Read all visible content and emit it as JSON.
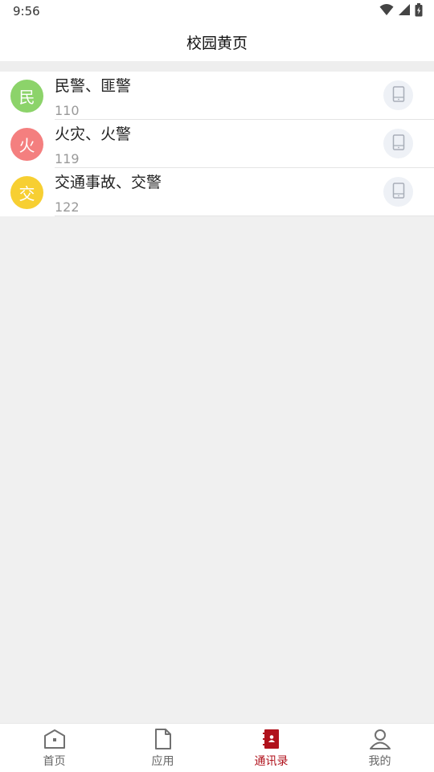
{
  "status_bar": {
    "time": "9:56",
    "icons": [
      "wifi-icon",
      "cell-signal-icon",
      "battery-icon"
    ]
  },
  "header": {
    "title": "校园黄页"
  },
  "contacts": [
    {
      "avatar_char": "民",
      "avatar_color": "#8cd36a",
      "name": "民警、匪警",
      "number": "110"
    },
    {
      "avatar_char": "火",
      "avatar_color": "#f47f7f",
      "name": "火灾、火警",
      "number": "119"
    },
    {
      "avatar_char": "交",
      "avatar_color": "#f7cf32",
      "name": "交通事故、交警",
      "number": "122"
    }
  ],
  "tabs": [
    {
      "label": "首页",
      "icon": "home-icon",
      "active": false
    },
    {
      "label": "应用",
      "icon": "document-icon",
      "active": false
    },
    {
      "label": "通讯录",
      "icon": "contacts-book-icon",
      "active": true
    },
    {
      "label": "我的",
      "icon": "person-icon",
      "active": false
    }
  ],
  "colors": {
    "accent": "#b0121c",
    "background": "#f0f0f0"
  }
}
